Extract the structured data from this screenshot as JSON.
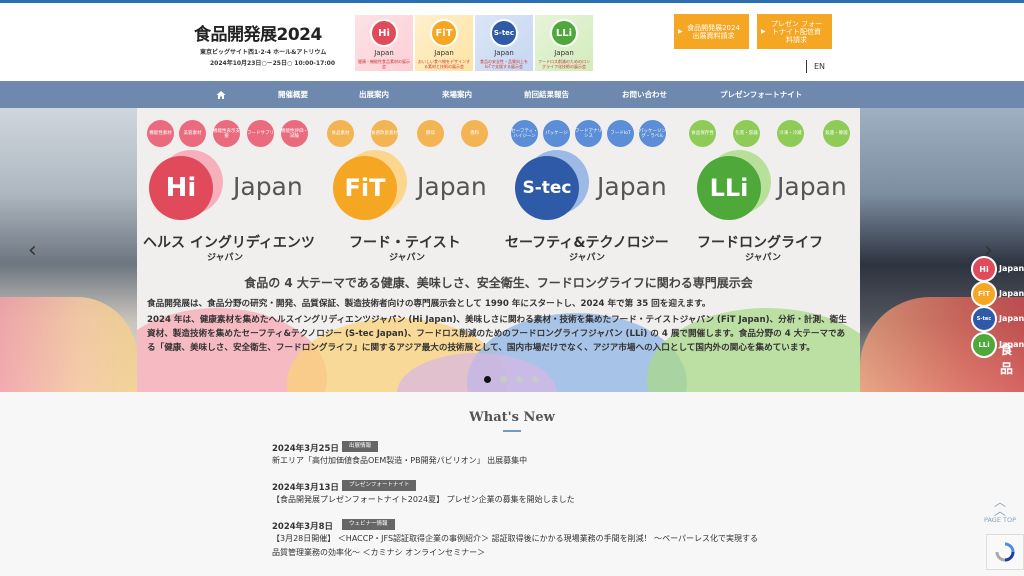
{
  "header": {
    "logo": {
      "title": "食品開発展2024",
      "sub": "東京ビッグサイト西1·2·4 ホール&アトリウム",
      "date": "2024年10月23日○－25日○ 10:00-17:00"
    },
    "brands": [
      {
        "abbr": "Hi",
        "name": "Japan",
        "desc": "健康・機能性食品素材の展示会",
        "color": "#e04a5a"
      },
      {
        "abbr": "FiT",
        "name": "Japan",
        "desc": "おいしい食べ物をデザインする素材と技術の展示会",
        "color": "#f5a623"
      },
      {
        "abbr": "S-tec",
        "name": "Japan",
        "desc": "食品の安全性・品質向上をIoTで支援する展示会",
        "color": "#2f5aa8"
      },
      {
        "abbr": "LLi",
        "name": "Japan",
        "desc": "フードロス削減のためのロングライフ化技術の展示会",
        "color": "#4fa83a"
      }
    ],
    "buttons": [
      {
        "label": "食品開発展2024出展資料請求"
      },
      {
        "label": "プレゼン フォートナイト配信資料請求"
      }
    ],
    "lang": "EN"
  },
  "nav": {
    "home_icon": "home-icon",
    "items": [
      "開催概要",
      "出展案内",
      "来場案内",
      "前回結果報告",
      "お問い合わせ",
      "プレゼンフォートナイト"
    ]
  },
  "hero": {
    "pills": [
      {
        "label": "機能性素材",
        "color": "#e96b7d"
      },
      {
        "label": "美容素材",
        "color": "#e96b7d"
      },
      {
        "label": "機能性表示支援",
        "color": "#e96b7d"
      },
      {
        "label": "フードサプリ",
        "color": "#e96b7d"
      },
      {
        "label": "機能性評価・試験",
        "color": "#e96b7d"
      },
      {
        "label": "食品素材",
        "color": "#f3b453"
      },
      {
        "label": "食感改良素材",
        "color": "#f3b453"
      },
      {
        "label": "酵母",
        "color": "#f3b453"
      },
      {
        "label": "香料",
        "color": "#f3b453"
      },
      {
        "label": "セーフティ・ハイジーン",
        "color": "#5b8ed6"
      },
      {
        "label": "パッケージ",
        "color": "#5b8ed6"
      },
      {
        "label": "フードアナリシス",
        "color": "#5b8ed6"
      },
      {
        "label": "フードIoT",
        "color": "#5b8ed6"
      },
      {
        "label": "パッケージング・ラベル",
        "color": "#5b8ed6"
      },
      {
        "label": "食品保存性",
        "color": "#8fcb57"
      },
      {
        "label": "包装・容器",
        "color": "#8fcb57"
      },
      {
        "label": "冷凍・冷蔵",
        "color": "#8fcb57"
      },
      {
        "label": "殺菌・静菌",
        "color": "#8fcb57"
      }
    ],
    "shows": [
      {
        "abbr": "Hi",
        "japan": "Japan",
        "kana": "ヘルス イングリディエンツ",
        "kana_sub": "ジャパン",
        "color": "#e04a5a"
      },
      {
        "abbr": "FiT",
        "japan": "Japan",
        "kana": "フード・テイスト",
        "kana_sub": "ジャパン",
        "color": "#f5a623"
      },
      {
        "abbr": "S-tec",
        "japan": "Japan",
        "kana": "セーフティ&テクノロジー",
        "kana_sub": "ジャパン",
        "color": "#2f5aa8"
      },
      {
        "abbr": "LLi",
        "japan": "Japan",
        "kana": "フードロングライフ",
        "kana_sub": "ジャパン",
        "color": "#4fa83a"
      }
    ],
    "headline": "食品の 4 大テーマである健康、美味しさ、安全衛生、フードロングライフに関わる専門展示会",
    "para1": "食品開発展は、食品分野の研究・開発、品質保証、製造技術者向けの専門展示会として 1990 年にスタートし、2024 年で第 35 回を迎えます。",
    "para2": "2024 年は、健康素材を集めたヘルスイングリディエンツジャパン (Hi Japan)、美味しさに関わる素材・技術を集めたフード・テイストジャパン (FiT Japan)、分析・計測、衛生資材、製造技術を集めたセーフティ&テクノロジー (S-tec Japan)、フードロス削減のためのフードロングライフジャパン (LLi) の 4 展で開催します。食品分野の 4 大テーマである「健康、美味しさ、安全衛生、フードロングライフ」に関するアジア最大の技術展として、国内市場だけでなく、アジア市場への入口として国内外の関心を集めています。",
    "right_title": "食品",
    "right_brands": [
      "Hi",
      "FiT",
      "S-tec",
      "LLi"
    ],
    "right_label": "Japan",
    "prev": "‹",
    "next": "›"
  },
  "news": {
    "heading": "What's New",
    "items": [
      {
        "date": "2024年3月25日",
        "badge": "出展情報",
        "text": "新エリア「高付加価値食品OEM製造・PB開発パビリオン」 出展募集中"
      },
      {
        "date": "2024年3月13日",
        "badge": "プレゼンフォートナイト",
        "text": "【食品開発展プレゼンフォートナイト2024夏】 プレゼン企業の募集を開始しました"
      },
      {
        "date": "2024年3月8日",
        "badge": "ウェビナー情報",
        "text": "【3月28日開催】 ＜HACCP・JFS認証取得企業の事例紹介＞ 認証取得後にかかる現場業務の手間を削減！ 〜ペーパーレス化で実現する品質管理業務の効率化〜 ＜カミナシ オンラインセミナー＞"
      }
    ],
    "page_top": "PAGE TOP"
  }
}
